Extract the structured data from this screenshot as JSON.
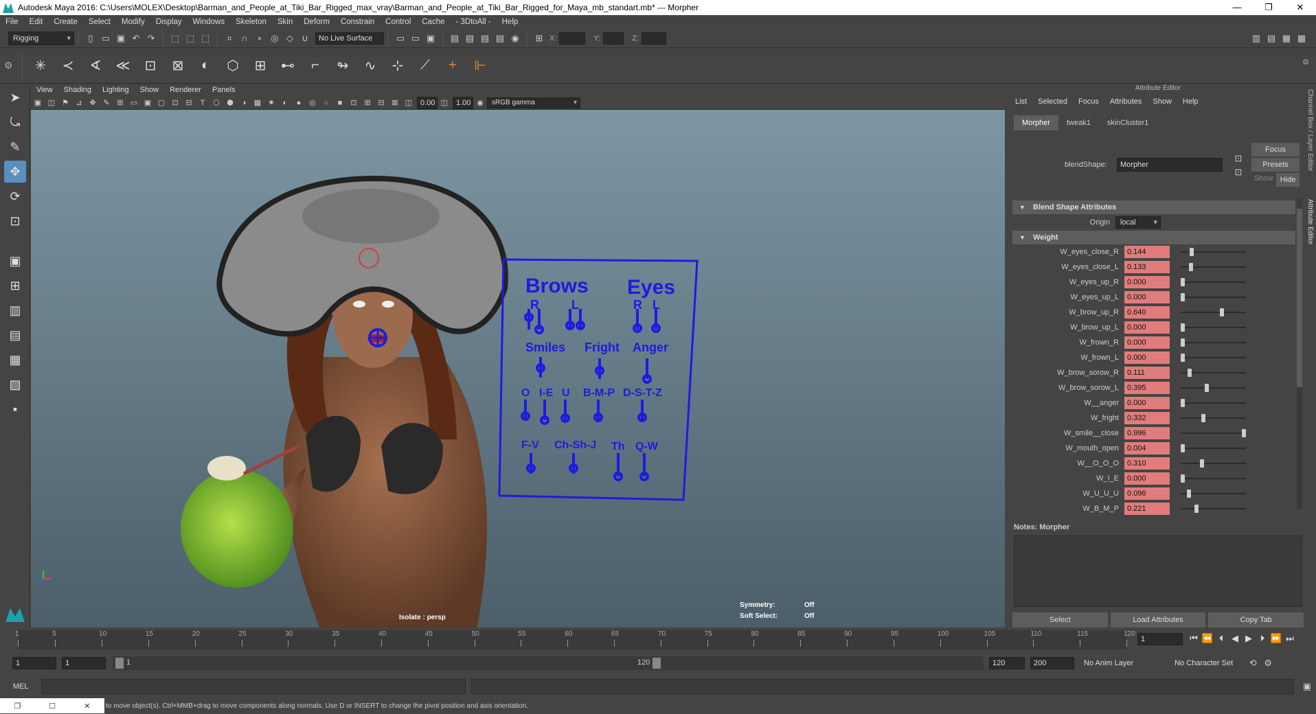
{
  "window": {
    "title": "Autodesk Maya 2016: C:\\Users\\MOLEX\\Desktop\\Barman_and_People_at_Tiki_Bar_Rigged_max_vray\\Barman_and_People_at_Tiki_Bar_Rigged_for_Maya_mb_standart.mb*   ---   Morpher",
    "min": "—",
    "max": "❐",
    "close": "✕"
  },
  "menu": [
    "File",
    "Edit",
    "Create",
    "Select",
    "Modify",
    "Display",
    "Windows",
    "Skeleton",
    "Skin",
    "Deform",
    "Constrain",
    "Control",
    "Cache",
    "- 3DtoAll -",
    "Help"
  ],
  "toolbar": {
    "mode": "Rigging",
    "live_surface": "No Live Surface",
    "x_label": "X:",
    "y_label": "Y:",
    "z_label": "Z:"
  },
  "panel": {
    "menu": [
      "View",
      "Shading",
      "Lighting",
      "Show",
      "Renderer",
      "Panels"
    ],
    "exposure": "0.00",
    "gamma": "1.00",
    "colorspace": "sRGB gamma"
  },
  "viewport": {
    "isolate": "Isolate : persp",
    "symmetry_label": "Symmetry:",
    "symmetry_value": "Off",
    "soft_select_label": "Soft Select:",
    "soft_select_value": "Off",
    "board": {
      "brows": "Brows",
      "eyes": "Eyes",
      "r1": "R",
      "l1": "L",
      "r2": "R",
      "l2": "L",
      "smiles": "Smiles",
      "fright": "Fright",
      "anger": "Anger",
      "o": "O",
      "ie": "I-E",
      "u": "U",
      "bmp": "B-M-P",
      "dstz": "D-S-T-Z",
      "fv": "F-V",
      "chshj": "Ch-Sh-J",
      "th": "Th",
      "qw": "Q-W"
    }
  },
  "attr": {
    "header": "Attribute Editor",
    "menu": [
      "List",
      "Selected",
      "Focus",
      "Attributes",
      "Show",
      "Help"
    ],
    "tabs": [
      "Morpher",
      "tweak1",
      "skinCluster1"
    ],
    "blendshape_label": "blendShape:",
    "blendshape_value": "Morpher",
    "focus": "Focus",
    "presets": "Presets",
    "show": "Show",
    "hide": "Hide",
    "section1": "Blend Shape Attributes",
    "origin_label": "Origin",
    "origin_value": "local",
    "section2": "Weight",
    "weights": [
      {
        "name": "W_eyes_close_R",
        "value": "0.144",
        "frac": 0.144
      },
      {
        "name": "W_eyes_close_L",
        "value": "0.133",
        "frac": 0.133
      },
      {
        "name": "W_eyes_up_R",
        "value": "0.000",
        "frac": 0.0
      },
      {
        "name": "W_eyes_up_L",
        "value": "0.000",
        "frac": 0.0
      },
      {
        "name": "W_brow_up_R",
        "value": "0.640",
        "frac": 0.64
      },
      {
        "name": "W_brow_up_L",
        "value": "0.000",
        "frac": 0.0
      },
      {
        "name": "W_frown_R",
        "value": "0.000",
        "frac": 0.0
      },
      {
        "name": "W_frown_L",
        "value": "0.000",
        "frac": 0.0
      },
      {
        "name": "W_brow_sorow_R",
        "value": "0.111",
        "frac": 0.111
      },
      {
        "name": "W_brow_sorow_L",
        "value": "0.395",
        "frac": 0.395
      },
      {
        "name": "W__anger",
        "value": "0.000",
        "frac": 0.0
      },
      {
        "name": "W_fright",
        "value": "0.332",
        "frac": 0.332
      },
      {
        "name": "W_smile__close",
        "value": "0.996",
        "frac": 0.996
      },
      {
        "name": "W_mouth_open",
        "value": "0.004",
        "frac": 0.004
      },
      {
        "name": "W__O_O_O",
        "value": "0.310",
        "frac": 0.31
      },
      {
        "name": "W_I_E",
        "value": "0.000",
        "frac": 0.0
      },
      {
        "name": "W_U_U_U",
        "value": "0.096",
        "frac": 0.096
      },
      {
        "name": "W_B_M_P",
        "value": "0.221",
        "frac": 0.221
      }
    ],
    "notes_label": "Notes:  Morpher",
    "btn_select": "Select",
    "btn_load": "Load Attributes",
    "btn_copy": "Copy Tab",
    "vtab1": "Channel Box / Layer Editor",
    "vtab2": "Attribute Editor"
  },
  "timeline": {
    "ticks": [
      "1",
      "5",
      "10",
      "15",
      "20",
      "25",
      "30",
      "35",
      "40",
      "45",
      "50",
      "55",
      "60",
      "65",
      "70",
      "75",
      "80",
      "85",
      "90",
      "95",
      "100",
      "105",
      "110",
      "115",
      "120"
    ],
    "current": "1"
  },
  "range": {
    "start": "1",
    "start2": "1",
    "slider_start": "1",
    "slider_end": "120",
    "end": "120",
    "end2": "200",
    "anim_layer": "No Anim Layer",
    "char_set": "No Character Set"
  },
  "cmd": {
    "lang": "MEL"
  },
  "help": {
    "text": "to move object(s). Ctrl+MMB+drag to move components along normals. Use D or INSERT to change the pivot position and axis orientation."
  }
}
